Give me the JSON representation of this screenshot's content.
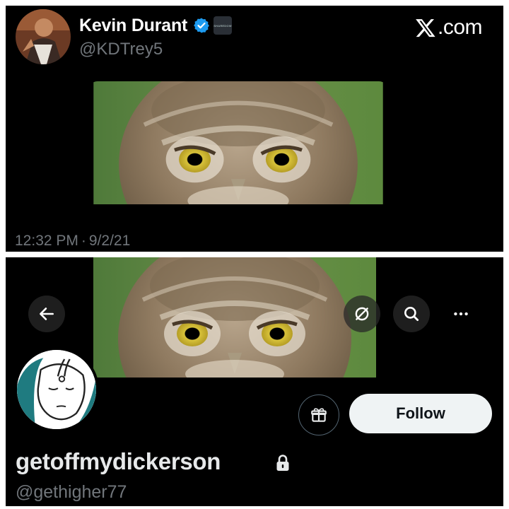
{
  "tweet": {
    "author_name": "Kevin Durant",
    "author_handle": "@KDTrey5",
    "affiliate_badge_text": "SHAREDOW",
    "brand_text": ".com",
    "timestamp_time": "12:32 PM",
    "timestamp_sep": "·",
    "timestamp_date": "9/2/21",
    "media": "owl-staring-image"
  },
  "profile": {
    "display_name": "getoffmydickerson",
    "handle": "@gethigher77",
    "follow_label": "Follow",
    "banner": "owl-staring-image",
    "toolbar_icons": [
      "back-arrow-icon",
      "grok-icon",
      "search-icon",
      "more-icon"
    ]
  },
  "colors": {
    "background": "#000000",
    "text_primary": "#e7e9ea",
    "text_secondary": "#71767b",
    "verified_blue": "#1d9bf0",
    "follow_button_bg": "#eff3f4"
  }
}
